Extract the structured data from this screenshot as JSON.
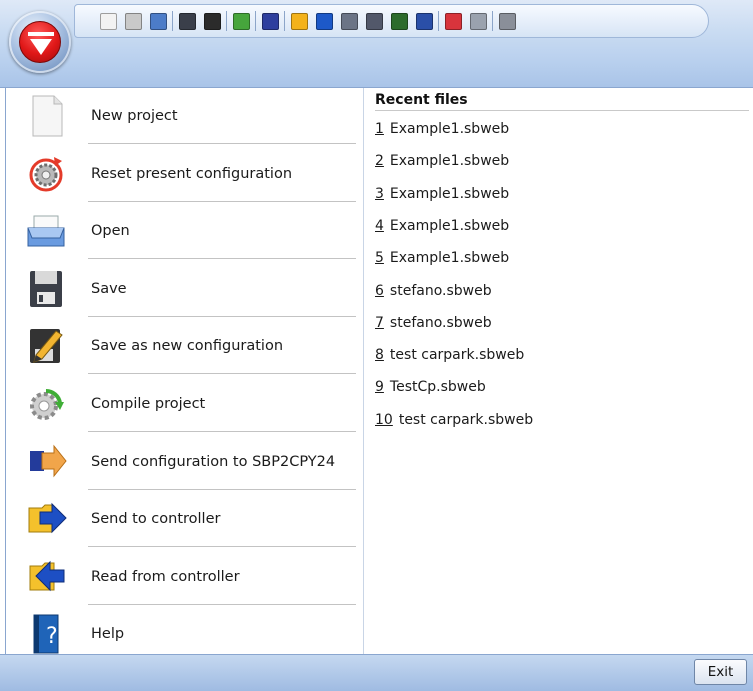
{
  "ribbon": {
    "quick_access_icons": [
      {
        "name": "new-icon",
        "color": "#f2f2f2"
      },
      {
        "name": "reset-icon",
        "color": "#c9c9c9"
      },
      {
        "name": "open-icon",
        "color": "#4c7cc8"
      },
      {
        "sep": true
      },
      {
        "name": "save-icon",
        "color": "#3a3f4a"
      },
      {
        "name": "save-as-icon",
        "color": "#2b2b2b"
      },
      {
        "sep": true
      },
      {
        "name": "compile-icon",
        "color": "#46a53c"
      },
      {
        "sep": true
      },
      {
        "name": "send-config-icon",
        "color": "#2e3f9e"
      },
      {
        "sep": true
      },
      {
        "name": "send-controller-icon",
        "color": "#f3b21b"
      },
      {
        "name": "read-controller-icon",
        "color": "#1d59c8"
      },
      {
        "name": "antenna-icon",
        "color": "#6b7486"
      },
      {
        "name": "wireless-icon",
        "color": "#52586a"
      },
      {
        "name": "network-icon",
        "color": "#2c6b2c"
      },
      {
        "name": "network-blue-icon",
        "color": "#2a4fa8"
      },
      {
        "sep": true
      },
      {
        "name": "monitor-color-icon",
        "color": "#d8343c"
      },
      {
        "name": "monitor-icon",
        "color": "#9aa2ae"
      },
      {
        "sep": true
      },
      {
        "name": "tools-icon",
        "color": "#8a8f99"
      }
    ]
  },
  "commands": [
    {
      "id": "new-project",
      "label": "New project",
      "icon": "new-project-icon"
    },
    {
      "id": "reset-configuration",
      "label": "Reset present configuration",
      "icon": "reset-gear-icon"
    },
    {
      "id": "open",
      "label": "Open",
      "icon": "open-tray-icon"
    },
    {
      "id": "save",
      "label": "Save",
      "icon": "floppy-disk-icon"
    },
    {
      "id": "save-as-new",
      "label": "Save as new configuration",
      "icon": "save-as-pencil-icon"
    },
    {
      "id": "compile-project",
      "label": "Compile project",
      "icon": "compile-gear-icon"
    },
    {
      "id": "send-config",
      "label": "Send configuration to SBP2CPY24",
      "icon": "send-config-arrow-icon"
    },
    {
      "id": "send-controller",
      "label": "Send to controller",
      "icon": "send-arrow-icon"
    },
    {
      "id": "read-controller",
      "label": "Read from controller",
      "icon": "read-arrow-icon"
    },
    {
      "id": "help",
      "label": "Help",
      "icon": "help-book-icon"
    }
  ],
  "recent": {
    "title": "Recent files",
    "files": [
      {
        "num": "1",
        "name": "Example1.sbweb"
      },
      {
        "num": "2",
        "name": "Example1.sbweb"
      },
      {
        "num": "3",
        "name": "Example1.sbweb"
      },
      {
        "num": "4",
        "name": "Example1.sbweb"
      },
      {
        "num": "5",
        "name": "Example1.sbweb"
      },
      {
        "num": "6",
        "name": "stefano.sbweb"
      },
      {
        "num": "7",
        "name": "stefano.sbweb"
      },
      {
        "num": "8",
        "name": "test carpark.sbweb"
      },
      {
        "num": "9",
        "name": "TestCp.sbweb"
      },
      {
        "num": "10",
        "name": "test carpark.sbweb"
      }
    ]
  },
  "footer": {
    "exit_label": "Exit"
  }
}
